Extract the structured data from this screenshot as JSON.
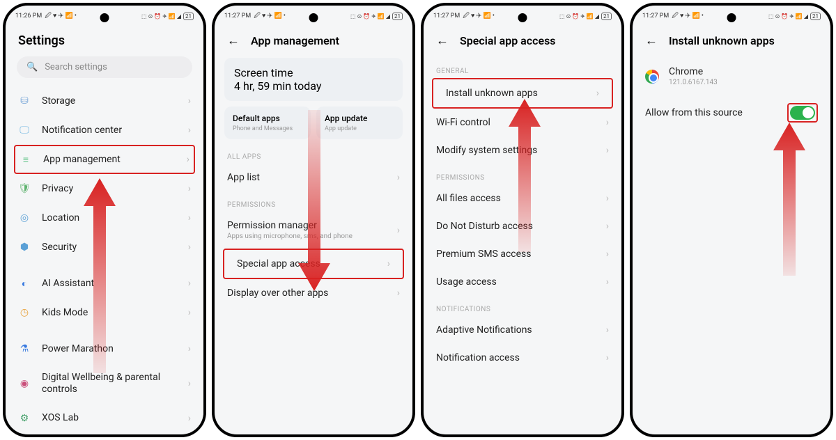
{
  "status": {
    "time1": "11:26 PM",
    "time2": "11:27 PM",
    "battery": "21",
    "icons_left": "🖉 ♥ ✈ 📶 •",
    "icons_right": "⬚ ⊙ ⏰ ✈ 📶 ◢"
  },
  "screen1": {
    "title": "Settings",
    "search_placeholder": "Search settings",
    "items": [
      {
        "icon": "#7aa7d8",
        "glyph": "⛁",
        "label": "Storage"
      },
      {
        "icon": "#6fb5e0",
        "glyph": "🖵",
        "label": "Notification center"
      },
      {
        "icon": "#68c78e",
        "glyph": "≡",
        "label": "App management",
        "hl": true
      },
      {
        "icon": "#5fb36f",
        "glyph": "🛡",
        "label": "Privacy"
      },
      {
        "icon": "#5aa0d6",
        "glyph": "◎",
        "label": "Location"
      },
      {
        "icon": "#5aa0d6",
        "glyph": "⬢",
        "label": "Security"
      },
      {
        "icon": "#3a7be0",
        "glyph": "◐",
        "label": "AI Assistant"
      },
      {
        "icon": "#e8a23c",
        "glyph": "◷",
        "label": "Kids Mode"
      },
      {
        "icon": "#3a7be0",
        "glyph": "⚗",
        "label": "Power Marathon"
      },
      {
        "icon": "#c94f7a",
        "glyph": "◉",
        "label": "Digital Wellbeing & parental controls"
      },
      {
        "icon": "#44a06a",
        "glyph": "⚙",
        "label": "XOS Lab"
      }
    ]
  },
  "screen2": {
    "title": "App management",
    "screen_time_label": "Screen time",
    "screen_time_value": "4 hr, 59 min today",
    "default_apps_label": "Default apps",
    "default_apps_sub": "Phone and Messages",
    "app_update_label": "App update",
    "app_update_sub": "App update",
    "section_all": "ALL APPS",
    "app_list_label": "App list",
    "section_perm": "PERMISSIONS",
    "perm_mgr_label": "Permission manager",
    "perm_mgr_sub": "Apps using microphone, sms, and phone",
    "special_label": "Special app access",
    "display_over_label": "Display over other apps"
  },
  "screen3": {
    "title": "Special app access",
    "section_general": "GENERAL",
    "install_unknown": "Install unknown apps",
    "wifi_control": "Wi-Fi control",
    "modify_system": "Modify system settings",
    "section_permissions": "PERMISSIONS",
    "all_files": "All files access",
    "dnd": "Do Not Disturb access",
    "sms": "Premium SMS access",
    "usage": "Usage access",
    "section_notif": "NOTIFICATIONS",
    "adaptive": "Adaptive Notifications",
    "notif_access": "Notification access"
  },
  "screen4": {
    "title": "Install unknown apps",
    "app_name": "Chrome",
    "app_version": "121.0.6167.143",
    "allow_label": "Allow from this source",
    "allow_value": true
  }
}
